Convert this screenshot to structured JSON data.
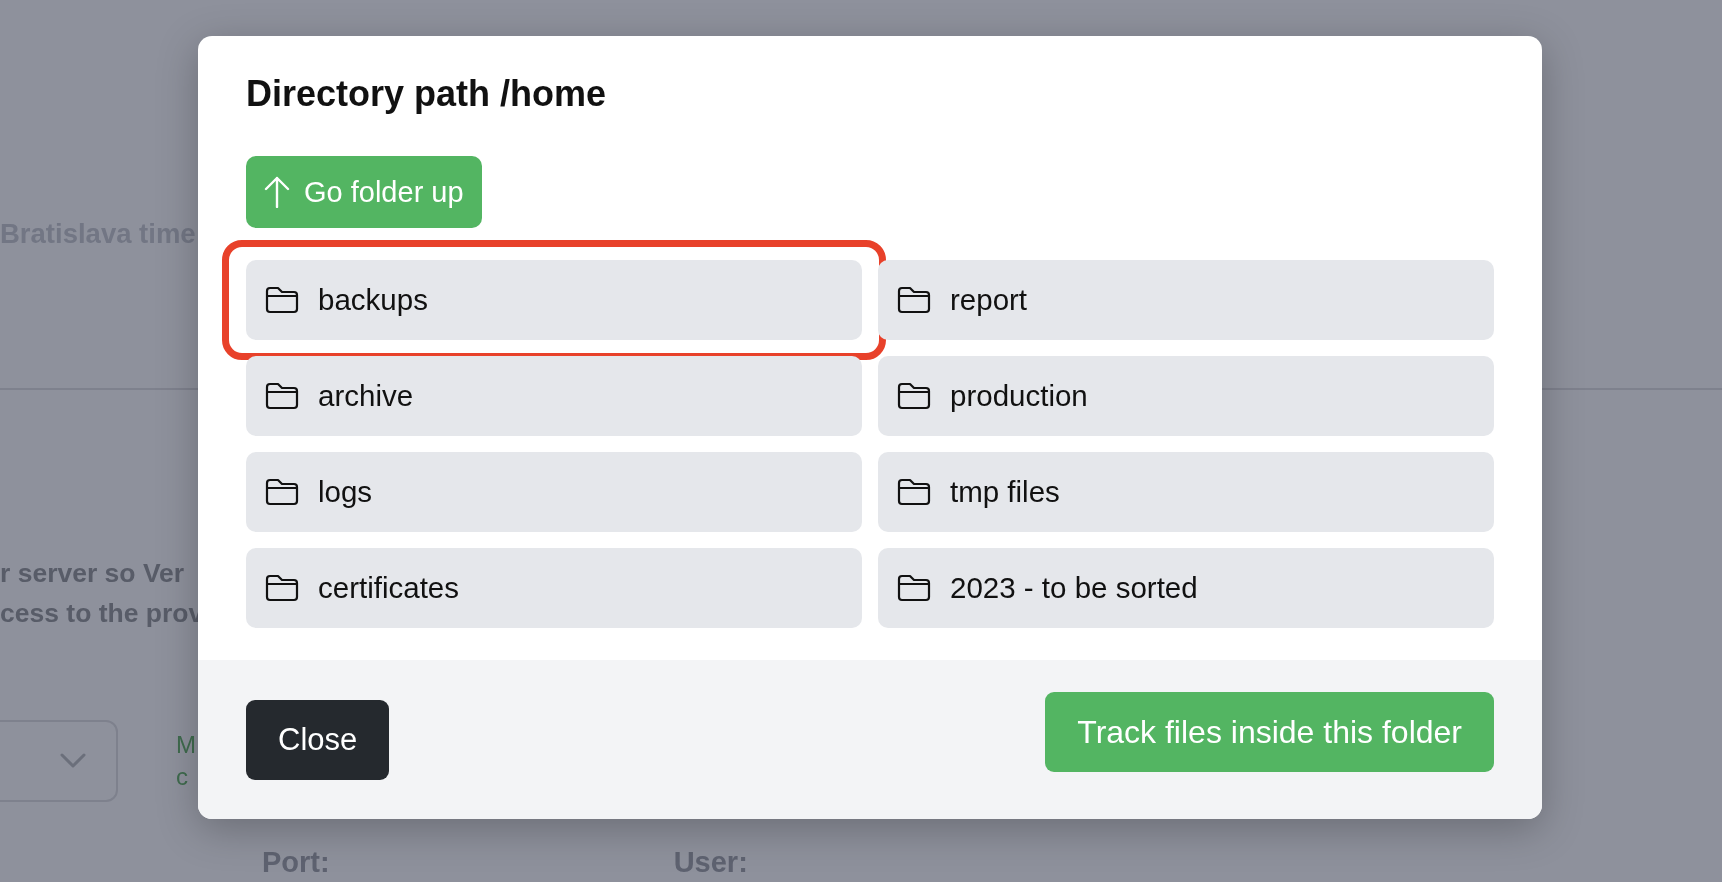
{
  "background": {
    "timezone_text": "Bratislava time",
    "description_lines": [
      "r server so Ver",
      "cess to the prov"
    ],
    "side_text": [
      "M",
      "c"
    ],
    "fields": [
      "Port:",
      "User:"
    ]
  },
  "dialog": {
    "title": "Directory path /home",
    "up_button": "Go folder up",
    "folders": [
      {
        "name": "backups",
        "highlighted": true
      },
      {
        "name": "report",
        "highlighted": false
      },
      {
        "name": "archive",
        "highlighted": false
      },
      {
        "name": "production",
        "highlighted": false
      },
      {
        "name": "logs",
        "highlighted": false
      },
      {
        "name": "tmp files",
        "highlighted": false
      },
      {
        "name": "certificates",
        "highlighted": false
      },
      {
        "name": "2023 - to be sorted",
        "highlighted": false
      }
    ],
    "close_button": "Close",
    "confirm_button": "Track files inside this folder"
  }
}
